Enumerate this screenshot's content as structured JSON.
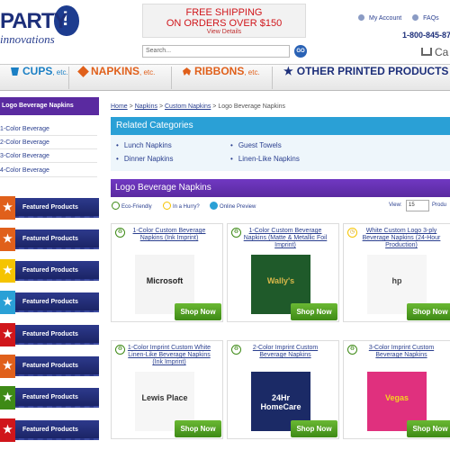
{
  "brand": {
    "name_top": "PARTY",
    "name_bottom": "innovations"
  },
  "promo": {
    "line1": "FREE SHIPPING",
    "line2": "ON ORDERS OVER $150",
    "link": "View Details"
  },
  "account": {
    "my_account": "My Account",
    "faqs": "FAQs",
    "links": "Li"
  },
  "phone": "1-800-845-87",
  "search": {
    "placeholder": "Search...",
    "button": "GO"
  },
  "cart_label": "Ca",
  "nav": [
    {
      "label": "CUPS",
      "suffix": ", etc.",
      "color": "#1a7fc4"
    },
    {
      "label": "NAPKINS",
      "suffix": ", etc.",
      "color": "#e0601b"
    },
    {
      "label": "RIBBONS",
      "suffix": ", etc.",
      "color": "#e0601b"
    },
    {
      "label": "OTHER PRINTED PRODUCTS",
      "suffix": "",
      "color": "#1d2f7a"
    }
  ],
  "sidebar": {
    "heading": "Logo Beverage Napkins",
    "items": [
      "1-Color Beverage",
      "2-Color Beverage",
      "3-Color Beverage",
      "4-Color Beverage"
    ],
    "featured_label": "Featured Products",
    "featured_colors": [
      "#e0601b",
      "#e0601b",
      "#f5c400",
      "#2aa0d6",
      "#d0161b",
      "#e0601b",
      "#3e8a16",
      "#d0161b"
    ]
  },
  "breadcrumb": {
    "home": "Home",
    "napkins": "Napkins",
    "custom": "Custom Napkins",
    "current": "Logo Beverage Napkins",
    "sep": ">"
  },
  "related": {
    "heading": "Related Categories",
    "links": [
      "Lunch Napkins",
      "Dinner Napkins",
      "Guest Towels",
      "Linen-Like Napkins"
    ]
  },
  "products": {
    "heading": "Logo Beverage Napkins",
    "filters": [
      "Eco-Friendly",
      "In a Hurry?",
      "Online Preview"
    ],
    "view_label": "View:",
    "view_value": "15",
    "view_suffix": "Produ",
    "shop_label": "Shop Now",
    "items": [
      {
        "title": "1-Color Custom Beverage Napkins (Ink Imprint)",
        "badge": "eco",
        "image_text": "Microsoft",
        "bg": "#f4f4f4",
        "fg": "#222"
      },
      {
        "title": "1-Color Custom Beverage Napkins (Matte & Metallic Foil Imprint)",
        "badge": "eco",
        "image_text": "Wally's",
        "bg": "#1f5a2a",
        "fg": "#d9b84a"
      },
      {
        "title": "White Custom Logo 3-ply Beverage Napkins (24-Hour Production)",
        "badge": "hurry",
        "image_text": "hp",
        "bg": "#f6f6f6",
        "fg": "#444"
      },
      {
        "title": "1-Color Imprint Custom White Linen-Like Beverage Napkins (Ink Imprint)",
        "badge": "eco",
        "image_text": "Lewis Place",
        "bg": "#f6f6f6",
        "fg": "#333"
      },
      {
        "title": "2-Color Imprint Custom Beverage Napkins",
        "badge": "eco",
        "image_text": "24Hr HomeCare",
        "bg": "#1b2a66",
        "fg": "#ffffff"
      },
      {
        "title": "3-Color Imprint Custom Beverage Napkins",
        "badge": "eco",
        "image_text": "Vegas",
        "bg": "#e0307e",
        "fg": "#f5d41f"
      }
    ]
  },
  "colors": {
    "purple": "#5a2aa0",
    "navy": "#1d2f7a",
    "blue": "#2aa0d6",
    "green": "#3e8a16",
    "red": "#d0161b"
  }
}
